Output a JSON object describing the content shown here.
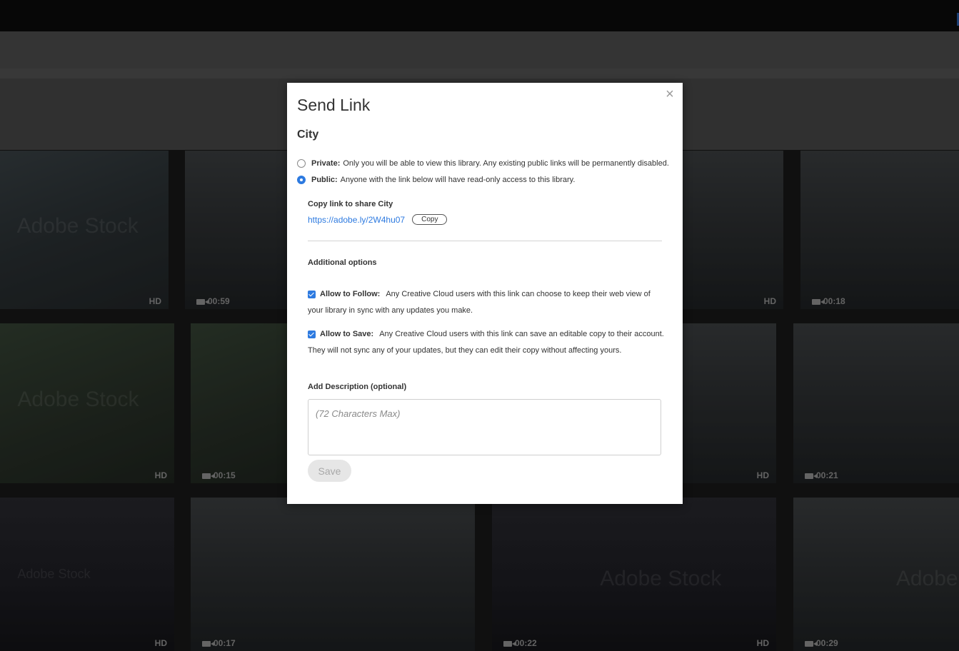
{
  "modal": {
    "title": "Send Link",
    "library_name": "City",
    "close_icon": "×",
    "private": {
      "label": "Private:",
      "text": "Only you will be able to view this library. Any existing public links will be permanently disabled.",
      "selected": false
    },
    "public": {
      "label": "Public:",
      "text": "Anyone with the link below will have read-only access to this library.",
      "selected": true
    },
    "copy_link_label": "Copy link to share City",
    "share_url": "https://adobe.ly/2W4hu07",
    "copy_button": "Copy",
    "additional_options": "Additional options",
    "allow_follow": {
      "label": "Allow to Follow:",
      "text": "Any Creative Cloud users with this link can choose to keep their web view of your library in sync with any updates you make.",
      "checked": true
    },
    "allow_save": {
      "label": "Allow to Save:",
      "text": "Any Creative Cloud users with this link can save an editable copy to their account. They will not sync any of your updates, but they can edit their copy without affecting yours.",
      "checked": true
    },
    "description_label": "Add Description (optional)",
    "description_placeholder": "(72 Characters Max)",
    "description_value": "",
    "save_button": "Save"
  },
  "background_tiles": [
    {
      "meta": "HD",
      "watermark": "Adobe Stock"
    },
    {
      "meta": "00:59",
      "watermark": ""
    },
    {
      "meta": "HD",
      "watermark": ""
    },
    {
      "meta": "00:18",
      "watermark": ""
    },
    {
      "meta": "HD",
      "watermark": "Adobe Stock"
    },
    {
      "meta": "00:15",
      "watermark": ""
    },
    {
      "meta": "HD",
      "watermark": ""
    },
    {
      "meta": "00:21",
      "watermark": ""
    },
    {
      "meta": "HD",
      "watermark": "Adobe Stock"
    },
    {
      "meta": "00:17",
      "watermark": ""
    },
    {
      "meta": "HD",
      "watermark": ""
    },
    {
      "meta": "00:22",
      "watermark": "Adobe Stock"
    },
    {
      "meta": "HD",
      "watermark": ""
    },
    {
      "meta": "00:29",
      "watermark": "Adobe"
    }
  ],
  "colors": {
    "accent": "#2d7ae0",
    "overlay": "rgba(0,0,0,0.35)"
  }
}
